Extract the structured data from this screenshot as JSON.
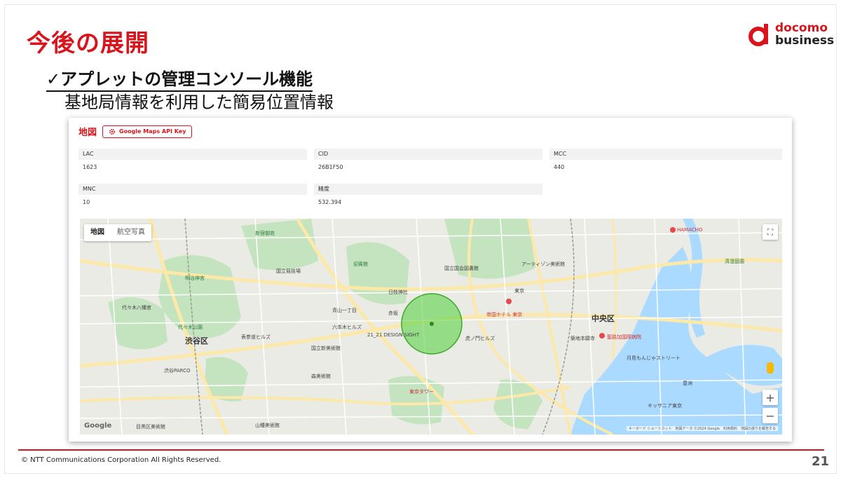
{
  "slide": {
    "title": "今後の展開",
    "heading": "✓アプレットの管理コンソール機能",
    "subheading": "基地局情報を利用した簡易位置情報",
    "logo_top": "docomo",
    "logo_bottom": "business",
    "copyright": "© NTT Communications Corporation All Rights Reserved.",
    "page_number": "21"
  },
  "colors": {
    "brand_red": "#d8151d",
    "accuracy_circle": "#4fd03a"
  },
  "console": {
    "title": "地図",
    "api_key_button": "Google Maps API Key",
    "fields": [
      {
        "label": "LAC",
        "value": "1623"
      },
      {
        "label": "CID",
        "value": "26B1F50"
      },
      {
        "label": "MCC",
        "value": "440"
      },
      {
        "label": "MNC",
        "value": "10"
      },
      {
        "label": "精度",
        "value": "532.394"
      }
    ]
  },
  "map": {
    "type_map": "地図",
    "type_satellite": "航空写真",
    "zoom_in": "+",
    "zoom_out": "−",
    "google": "Google",
    "attribution": "キーボード ショートカット　地図データ ©2024 Google　利用規約　地図の誤りを報告する",
    "labels": {
      "shibuya": "渋谷区",
      "chuo": "中央区",
      "yoyogi_park": "代々木公園",
      "meiji_jingu": "明治神宮",
      "shinjuku_gyoen": "新宿御苑",
      "akasaka": "赤坂",
      "tokyo_tower": "東京タワー",
      "imperial_hotel": "帝国ホテル 東京",
      "roppongi_hills": "六本木ヒルズ",
      "design_sight": "21_21 DESIGN SIGHT",
      "mori_museum": "森美術館",
      "national_art_center": "国立新美術館",
      "omotesando_hills": "表参道ヒルズ",
      "shibuya_parco": "渋谷PARCO",
      "national_diet_library": "国立国会図書館",
      "hamacho": "HAMACHO",
      "kidzania": "キッザニア東京",
      "tsukiji": "築地本願寺",
      "st_luke": "聖路加国際病院",
      "hie_shrine": "日枝神社",
      "toranomon_hills": "虎ノ門ヒルズ",
      "artizon": "アーティゾン美術館",
      "yoyogi_hachiman": "代々木八幡宮",
      "akasaka_palace": "迎賓館",
      "national_stadium": "国立競技場",
      "tsukishima": "月島もんじゃストリート",
      "aoyama": "青山一丁目",
      "toyosu": "豊洲",
      "kiyosumi": "清澄庭園",
      "tokyo_big": "東京",
      "yamatane": "山種美術館",
      "meguro_museum": "目黒区美術館"
    }
  }
}
